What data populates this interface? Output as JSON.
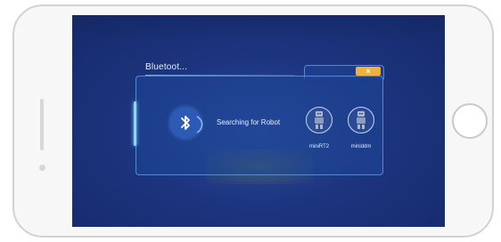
{
  "dialog": {
    "title": "Bluetoot...",
    "close_label": "×",
    "status_text": "Searching for Robot"
  },
  "robots": [
    {
      "name": "miniRT2",
      "icon": "robot-icon"
    },
    {
      "name": "miniddm",
      "icon": "robot-icon"
    }
  ],
  "colors": {
    "background": "#1d3580",
    "panel": "#1e4696",
    "accent": "#f0b23c",
    "bluetooth": "#2d5ab4"
  }
}
